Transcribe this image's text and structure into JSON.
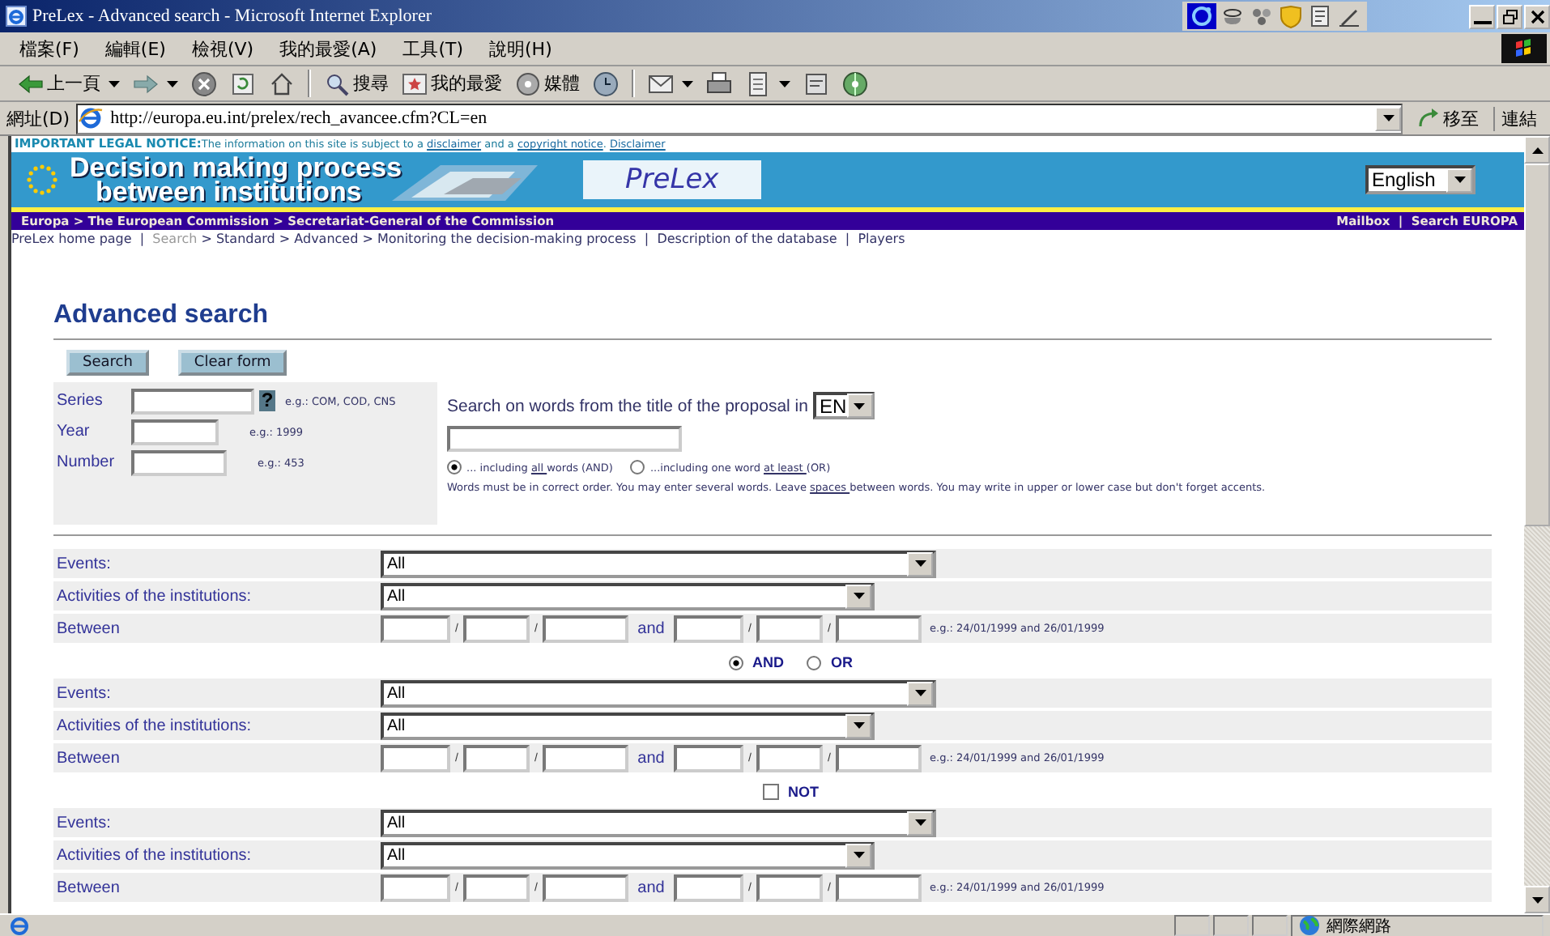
{
  "window": {
    "title": "PreLex - Advanced search - Microsoft Internet Explorer"
  },
  "menu": [
    "檔案(F)",
    "編輯(E)",
    "檢視(V)",
    "我的最愛(A)",
    "工具(T)",
    "說明(H)"
  ],
  "toolbar": [
    {
      "kind": "back",
      "label": "上一頁"
    },
    {
      "kind": "forward"
    },
    {
      "kind": "stop"
    },
    {
      "kind": "refresh"
    },
    {
      "kind": "home"
    },
    {
      "kind": "separator"
    },
    {
      "kind": "search",
      "label": "搜尋"
    },
    {
      "kind": "favorites",
      "label": "我的最愛"
    },
    {
      "kind": "media",
      "label": "媒體"
    },
    {
      "kind": "history"
    },
    {
      "kind": "separator"
    },
    {
      "kind": "mail"
    },
    {
      "kind": "print"
    },
    {
      "kind": "edit"
    },
    {
      "kind": "discuss"
    },
    {
      "kind": "messenger"
    }
  ],
  "address_bar": {
    "label": "網址(D)",
    "url": "http://europa.eu.int/prelex/rech_avancee.cfm?CL=en",
    "go": "移至",
    "links": "連結"
  },
  "legal_notice": [
    {
      "kind": "strong",
      "text": "IMPORTANT LEGAL NOTICE:"
    },
    {
      "kind": "text",
      "text": "The information on this site is subject to a "
    },
    {
      "kind": "link",
      "text": "disclaimer"
    },
    {
      "kind": "text",
      "text": " and a "
    },
    {
      "kind": "link",
      "text": "copyright notice"
    },
    {
      "kind": "text",
      "text": ". "
    },
    {
      "kind": "link",
      "text": "Disclaimer"
    }
  ],
  "banner": {
    "title_lines": [
      "Decision making process",
      "between institutions"
    ],
    "logo": "PreLex",
    "language": "English"
  },
  "breadcrumb": {
    "separator": ">",
    "items": [
      "Europa",
      "The European Commission",
      "Secretariat-General of the Commission"
    ]
  },
  "top_links": {
    "separator": "|",
    "items": [
      "Mailbox",
      "Search EUROPA"
    ]
  },
  "nav_links": {
    "group_separator": "|",
    "step_separator": ">",
    "groups": [
      [
        {
          "label": "PreLex home page",
          "disabled": false
        }
      ],
      [
        {
          "label": "Search",
          "disabled": true
        },
        {
          "label": "Standard",
          "disabled": false
        },
        {
          "label": "Advanced",
          "disabled": false
        },
        {
          "label": "Monitoring the decision-making process",
          "disabled": false
        }
      ],
      [
        {
          "label": "Description of the database",
          "disabled": false
        }
      ],
      [
        {
          "label": "Players",
          "disabled": false
        }
      ]
    ]
  },
  "heading": "Advanced search",
  "buttons": [
    "Search",
    "Clear form"
  ],
  "fields": [
    {
      "label": "Series",
      "help": "?",
      "example": "e.g.: COM, COD, CNS"
    },
    {
      "label": "Year",
      "example": "e.g.: 1999"
    },
    {
      "label": "Number",
      "example": "e.g.: 453"
    }
  ],
  "title_search": {
    "label": "Search on words from the title of the proposal in",
    "language": "EN",
    "options": [
      {
        "selected": true,
        "parts": [
          {
            "kind": "text",
            "text": "... including "
          },
          {
            "kind": "link",
            "text": "all "
          },
          {
            "kind": "text",
            "text": "words (AND)"
          }
        ]
      },
      {
        "selected": false,
        "parts": [
          {
            "kind": "text",
            "text": "...including one word "
          },
          {
            "kind": "link",
            "text": "at least "
          },
          {
            "kind": "text",
            "text": "(OR)"
          }
        ]
      }
    ],
    "note": [
      {
        "kind": "text",
        "text": "Words must be in correct order. You may enter several words. Leave "
      },
      {
        "kind": "link",
        "text": "spaces "
      },
      {
        "kind": "text",
        "text": "between words. You may write in upper or lower case but don't forget accents."
      }
    ]
  },
  "criteria": [
    {
      "kind": "group",
      "rows": [
        {
          "kind": "select",
          "label": "Events:",
          "value": "All"
        },
        {
          "kind": "select",
          "label": "Activities of the institutions:",
          "value": "All"
        },
        {
          "kind": "dates",
          "label": "Between",
          "separator": "/",
          "conjunction": "and",
          "example": "e.g.: 24/01/1999 and 26/01/1999"
        }
      ]
    },
    {
      "kind": "radio",
      "options": [
        {
          "label": "AND",
          "selected": true
        },
        {
          "label": "OR",
          "selected": false
        }
      ]
    },
    {
      "kind": "group",
      "rows": [
        {
          "kind": "select",
          "label": "Events:",
          "value": "All"
        },
        {
          "kind": "select",
          "label": "Activities of the institutions:",
          "value": "All"
        },
        {
          "kind": "dates",
          "label": "Between",
          "separator": "/",
          "conjunction": "and",
          "example": "e.g.: 24/01/1999 and 26/01/1999"
        }
      ]
    },
    {
      "kind": "checkbox",
      "label": "NOT",
      "checked": false
    },
    {
      "kind": "group",
      "rows": [
        {
          "kind": "select",
          "label": "Events:",
          "value": "All"
        },
        {
          "kind": "select",
          "label": "Activities of the institutions:",
          "value": "All"
        },
        {
          "kind": "dates",
          "label": "Between",
          "separator": "/",
          "conjunction": "and",
          "example": "e.g.: 24/01/1999 and 26/01/1999"
        }
      ]
    }
  ],
  "status_bar": {
    "zone": "網際網路"
  }
}
